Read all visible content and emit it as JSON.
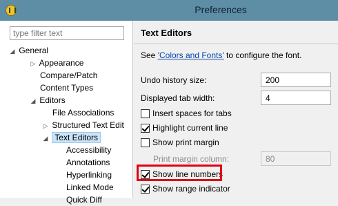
{
  "window": {
    "title": "Preferences",
    "app_icon": "eclipse-icon"
  },
  "filter": {
    "placeholder": "type filter text"
  },
  "tree": [
    {
      "label": "General",
      "twisty": "◢"
    },
    {
      "label": "Appearance",
      "twisty": "▷"
    },
    {
      "label": "Compare/Patch",
      "twisty": ""
    },
    {
      "label": "Content Types",
      "twisty": ""
    },
    {
      "label": "Editors",
      "twisty": "◢"
    },
    {
      "label": "File Associations",
      "twisty": ""
    },
    {
      "label": "Structured Text Edit",
      "twisty": "▷"
    },
    {
      "label": "Text Editors",
      "twisty": "◢"
    },
    {
      "label": "Accessibility",
      "twisty": ""
    },
    {
      "label": "Annotations",
      "twisty": ""
    },
    {
      "label": "Hyperlinking",
      "twisty": ""
    },
    {
      "label": "Linked Mode",
      "twisty": ""
    },
    {
      "label": "Quick Diff",
      "twisty": ""
    }
  ],
  "page": {
    "title": "Text Editors",
    "see_prefix": "See ",
    "see_link": "'Colors and Fonts'",
    "see_suffix": " to configure the font.",
    "undo_label": "Undo history size:",
    "undo_value": "200",
    "tab_label": "Displayed tab width:",
    "tab_value": "4",
    "insert_spaces": "Insert spaces for tabs",
    "highlight_line": "Highlight current line",
    "print_margin": "Show print margin",
    "print_margin_col_label": "Print margin column:",
    "print_margin_col_value": "80",
    "line_numbers": "Show line numbers",
    "range_indicator": "Show range indicator"
  },
  "colors": {
    "titlebar": "#5e8ea6",
    "selection": "#cce4f7",
    "highlight": "#e00010",
    "link": "#0645ad"
  }
}
